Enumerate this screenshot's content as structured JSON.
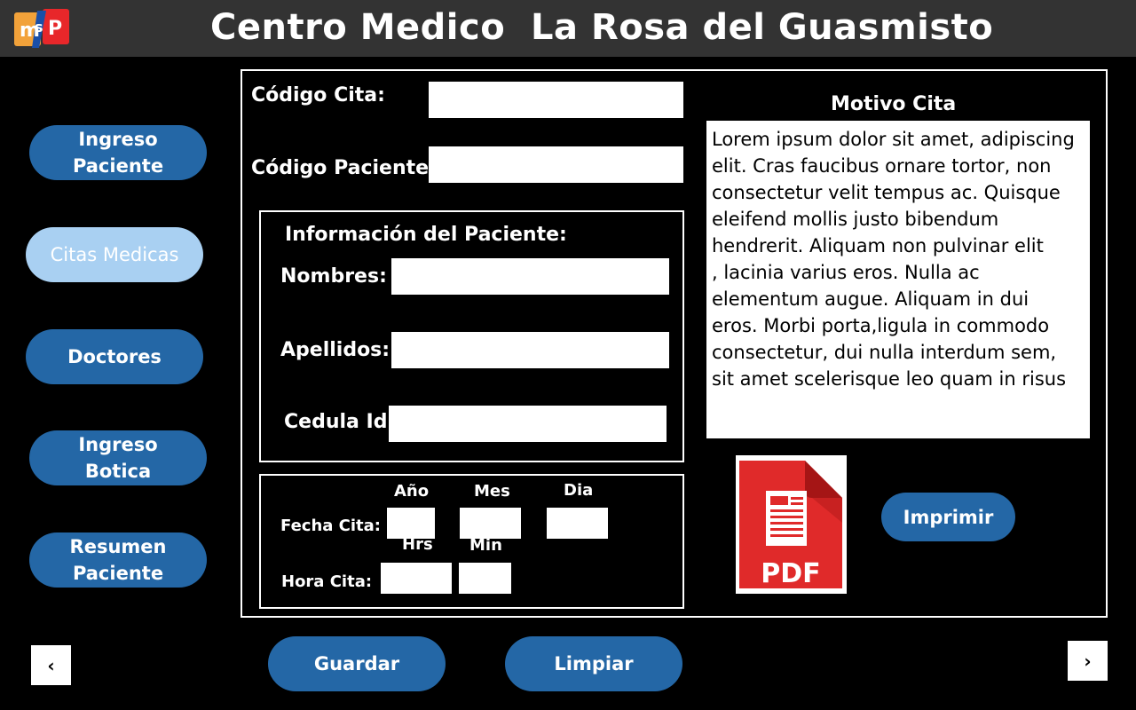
{
  "header": {
    "title": "Centro Medico  La Rosa del Guasmisto",
    "logo_text_m": "m",
    "logo_text_s": "s",
    "logo_text_p": "P"
  },
  "sidebar": {
    "items": [
      {
        "label": "Ingreso\nPaciente"
      },
      {
        "label": "Citas Medicas"
      },
      {
        "label": "Doctores"
      },
      {
        "label": "Ingreso\n Botica"
      },
      {
        "label": "Resumen\nPaciente"
      }
    ]
  },
  "form": {
    "codigo_cita_label": "Código Cita:",
    "codigo_cita_value": "",
    "codigo_paciente_label": "Código Paciente:",
    "codigo_paciente_value": "",
    "info_title": "Información del Paciente:",
    "nombres_label": "Nombres:",
    "nombres_value": "",
    "apellidos_label": "Apellidos:",
    "apellidos_value": "",
    "cedula_label": "Cedula Id:",
    "cedula_value": "",
    "fecha_label": "Fecha Cita:",
    "anio_label": "Año",
    "mes_label": "Mes",
    "dia_label": "Dia",
    "hora_label": "Hora Cita:",
    "hrs_label": "Hrs",
    "min_label": "Min"
  },
  "motivo": {
    "title": "Motivo Cita",
    "text": "Lorem ipsum dolor sit amet, adipiscing\nelit. Cras faucibus ornare tortor, non\nconsectetur velit tempus ac. Quisque\neleifend mollis justo bibendum\nhendrerit. Aliquam non pulvinar elit\n, lacinia varius eros. Nulla ac\nelementum augue. Aliquam in dui\neros. Morbi porta,ligula in commodo\n consectetur, dui nulla interdum sem,\nsit amet scelerisque leo quam in risus"
  },
  "pdf": {
    "label": "PDF"
  },
  "actions": {
    "print_label": "Imprimir",
    "save_label": "Guardar",
    "clear_label": "Limpiar"
  },
  "pager": {
    "prev": "‹",
    "next": "›"
  },
  "colors": {
    "topbar": "#333333",
    "button": "#2467a6",
    "active_button": "#a9d0f2",
    "pdf_red": "#e02a2a"
  }
}
